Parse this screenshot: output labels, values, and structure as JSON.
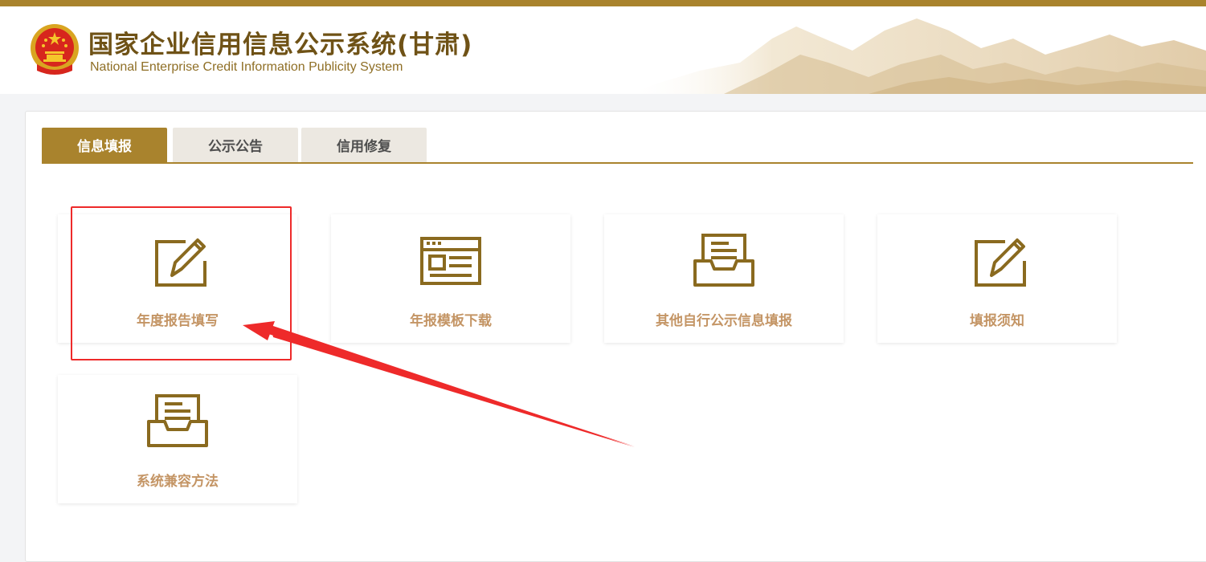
{
  "header": {
    "title_cn": "国家企业信用信息公示系统(甘肃)",
    "title_en": "National Enterprise Credit Information Publicity System"
  },
  "tabs": [
    {
      "label": "信息填报",
      "active": true
    },
    {
      "label": "公示公告",
      "active": false
    },
    {
      "label": "信用修复",
      "active": false
    }
  ],
  "cards": [
    {
      "label": "年度报告填写",
      "icon": "edit-pencil-icon"
    },
    {
      "label": "年报模板下载",
      "icon": "template-document-icon"
    },
    {
      "label": "其他自行公示信息填报",
      "icon": "inbox-tray-icon"
    },
    {
      "label": "填报须知",
      "icon": "edit-pencil-icon"
    },
    {
      "label": "系统兼容方法",
      "icon": "inbox-tray-icon"
    }
  ],
  "colors": {
    "brand_gold": "#a9832d",
    "icon_brown": "#8a6a1f",
    "card_label": "#c49565",
    "annotation_red": "#ee2a2a"
  }
}
